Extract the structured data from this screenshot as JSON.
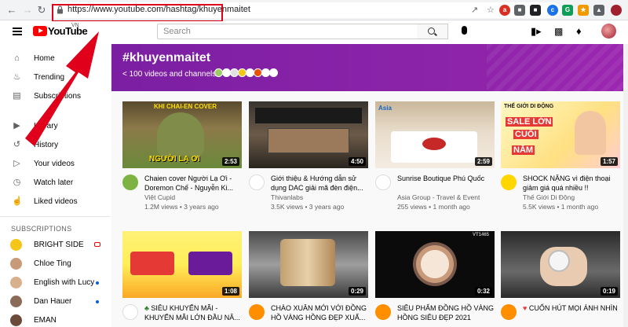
{
  "browser": {
    "url": "https://www.youtube.com/hashtag/khuyenmaitet"
  },
  "header": {
    "logo_text": "YouTube",
    "country": "VN",
    "search_placeholder": "Search"
  },
  "sidebar": {
    "items": [
      {
        "label": "Home",
        "icon": "home-icon"
      },
      {
        "label": "Trending",
        "icon": "flame-icon"
      },
      {
        "label": "Subscriptions",
        "icon": "subscriptions-icon"
      },
      {
        "label": "Library",
        "icon": "library-icon"
      },
      {
        "label": "History",
        "icon": "history-icon"
      },
      {
        "label": "Your videos",
        "icon": "play-square-icon"
      },
      {
        "label": "Watch later",
        "icon": "clock-icon"
      },
      {
        "label": "Liked videos",
        "icon": "thumbs-up-icon"
      }
    ],
    "subscriptions_title": "SUBSCRIPTIONS",
    "subscriptions": [
      {
        "name": "BRIGHT SIDE",
        "indicator": "live",
        "color": "#f5c518"
      },
      {
        "name": "Chloe Ting",
        "indicator": "",
        "color": "#c99a7a"
      },
      {
        "name": "English with Lucy",
        "indicator": "new",
        "color": "#d8b08c"
      },
      {
        "name": "Dan Hauer",
        "indicator": "new",
        "color": "#8c6a58"
      },
      {
        "name": "EMAN",
        "indicator": "",
        "color": "#6b4a3a"
      }
    ]
  },
  "hashtag": {
    "title": "#khuyenmaitet",
    "subtitle": "< 100 videos and channels"
  },
  "videos": [
    {
      "title": "Chaien cover Người Lạ Ơi - Doremon Chế - Nguyễn Ki...",
      "channel": "Việt Cupid",
      "meta": "1.2M views • 3 years ago",
      "duration": "2:53",
      "thumb_top": "KHI CHAI-EN COVER",
      "thumb_bottom": "NGƯỜI LẠ ƠI"
    },
    {
      "title": "Giới thiệu & Hướng dẫn sử dụng DAC giải mã đèn điện...",
      "channel": "Thivanlabs",
      "meta": "3.5K views • 3 years ago",
      "duration": "4:50"
    },
    {
      "title": "Sunrise Boutique Phú Quốc",
      "channel": "Asia Group - Travel & Event",
      "meta": "255 views • 1 month ago",
      "duration": "2:59",
      "thumb_top": "Asia"
    },
    {
      "title": "SHOCK NẶNG vì điện thoại giảm giá quá nhiều !!",
      "channel": "Thế Giới Di Động",
      "meta": "5.5K views • 1 month ago",
      "duration": "1:57",
      "thumb_top": "THẾ GIỚI DI ĐỘNG",
      "thumb_mid": "SALE LỚN",
      "thumb_mid2": "CUỐI",
      "thumb_bottom": "NĂM"
    },
    {
      "title": "SIÊU KHUYẾN MÃI - KHUYẾN MÃI LỚN ĐẦU NĂ...",
      "duration": "1:08",
      "title_prefix_icon": "clover-icon"
    },
    {
      "title": "CHÀO XUÂN MỚI VỚI ĐỒNG HỒ VÀNG HỒNG ĐẸP XUẤ...",
      "duration": "0:29"
    },
    {
      "title": "SIÊU PHẨM ĐỒNG HỒ VÀNG HỒNG SIÊU ĐẸP 2021",
      "duration": "0:32",
      "thumb_top": "VT1465"
    },
    {
      "title": "CUỐN HÚT MỌI ÁNH NHÌN",
      "duration": "0:19",
      "title_prefix_icon": "heart-icon"
    }
  ],
  "colors": {
    "accent": "#ff0000",
    "banner": "#7b1fa2",
    "annotation": "#e0001b"
  }
}
